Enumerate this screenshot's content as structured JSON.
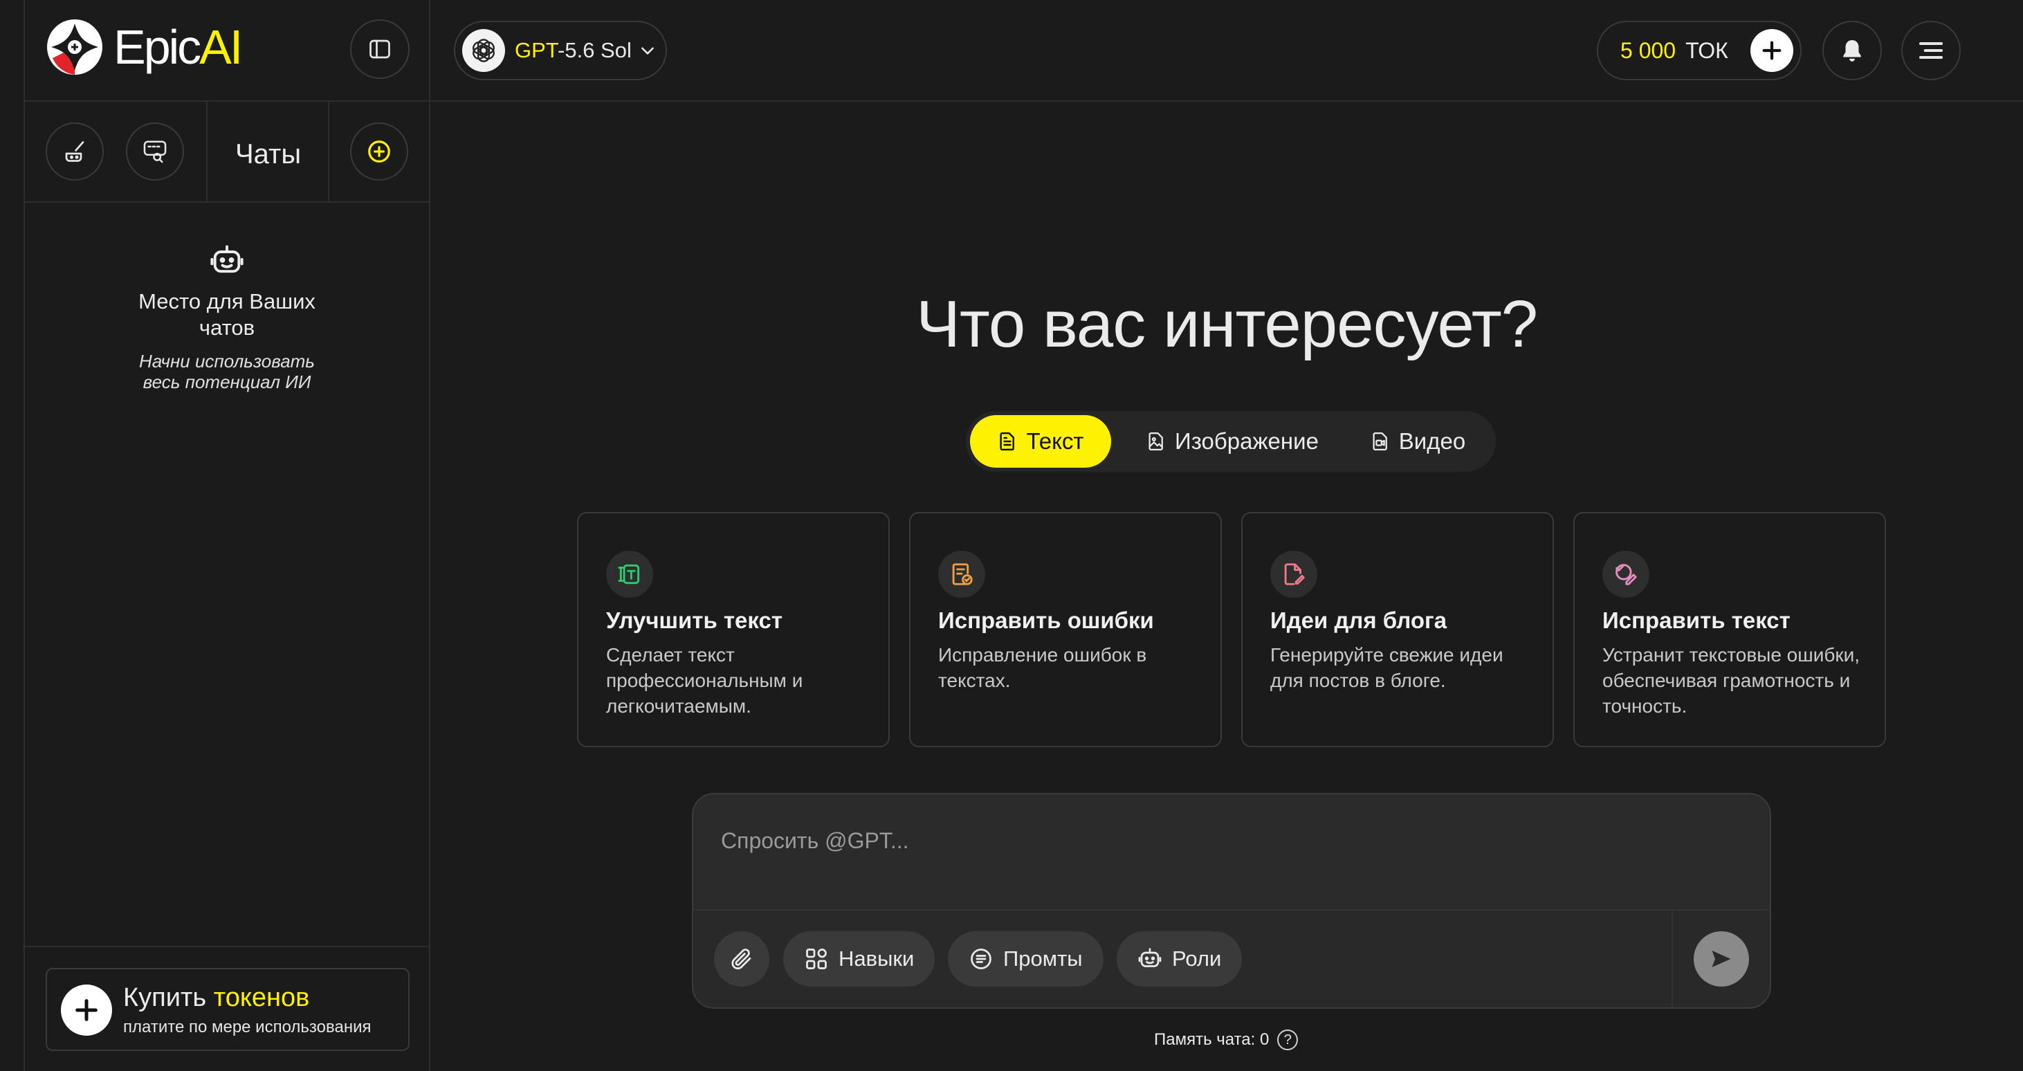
{
  "brand": {
    "name_part1": "Epic",
    "name_part2": "AI",
    "accent_color": "#fff200"
  },
  "header": {
    "model": {
      "name_part1": "GPT",
      "name_part2": "-5.6 Sol",
      "icon": "openai-icon"
    },
    "tokens": {
      "amount": "5 000",
      "unit": "ТОК"
    },
    "icons": [
      "sidebar-toggle-icon",
      "chevron-down-icon",
      "plus-icon",
      "bell-icon",
      "menu-icon"
    ]
  },
  "sidebar": {
    "title": "Чаты",
    "empty": {
      "title": "Место для Ваших чатов",
      "subtitle": "Начни использовать весь потенциал ИИ"
    },
    "buy": {
      "title_part1": "Купить",
      "title_part2": "токенов",
      "subtitle": "платите по мере использования"
    }
  },
  "main": {
    "headline": "Что вас интересует?",
    "tabs": [
      {
        "label": "Текст",
        "active": true,
        "icon": "document-icon"
      },
      {
        "label": "Изображение",
        "active": false,
        "icon": "image-file-icon"
      },
      {
        "label": "Видео",
        "active": false,
        "icon": "video-file-icon"
      }
    ],
    "cards": [
      {
        "title": "Улучшить текст",
        "description": "Сделает текст профессиональным и легкочитаемым.",
        "icon": "text-improve-icon",
        "icon_color": "#2ecc71"
      },
      {
        "title": "Исправить ошибки",
        "description": "Исправление ошибок в текстах.",
        "icon": "doc-check-icon",
        "icon_color": "#f0a040"
      },
      {
        "title": "Идеи для блога",
        "description": "Генерируйте свежие идеи для постов в блоге.",
        "icon": "doc-edit-icon",
        "icon_color": "#f07a8a"
      },
      {
        "title": "Исправить текст",
        "description": "Устранит текстовые ошибки, обеспечивая грамотность и точность.",
        "icon": "check-pen-icon",
        "icon_color": "#e88cc0"
      }
    ],
    "composer": {
      "placeholder": "Спросить @GPT...",
      "chips": [
        {
          "label": "Навыки",
          "icon": "apps-icon"
        },
        {
          "label": "Промты",
          "icon": "list-circle-icon"
        },
        {
          "label": "Роли",
          "icon": "robot-icon"
        }
      ]
    },
    "memory": {
      "label": "Память чата: 0"
    }
  }
}
